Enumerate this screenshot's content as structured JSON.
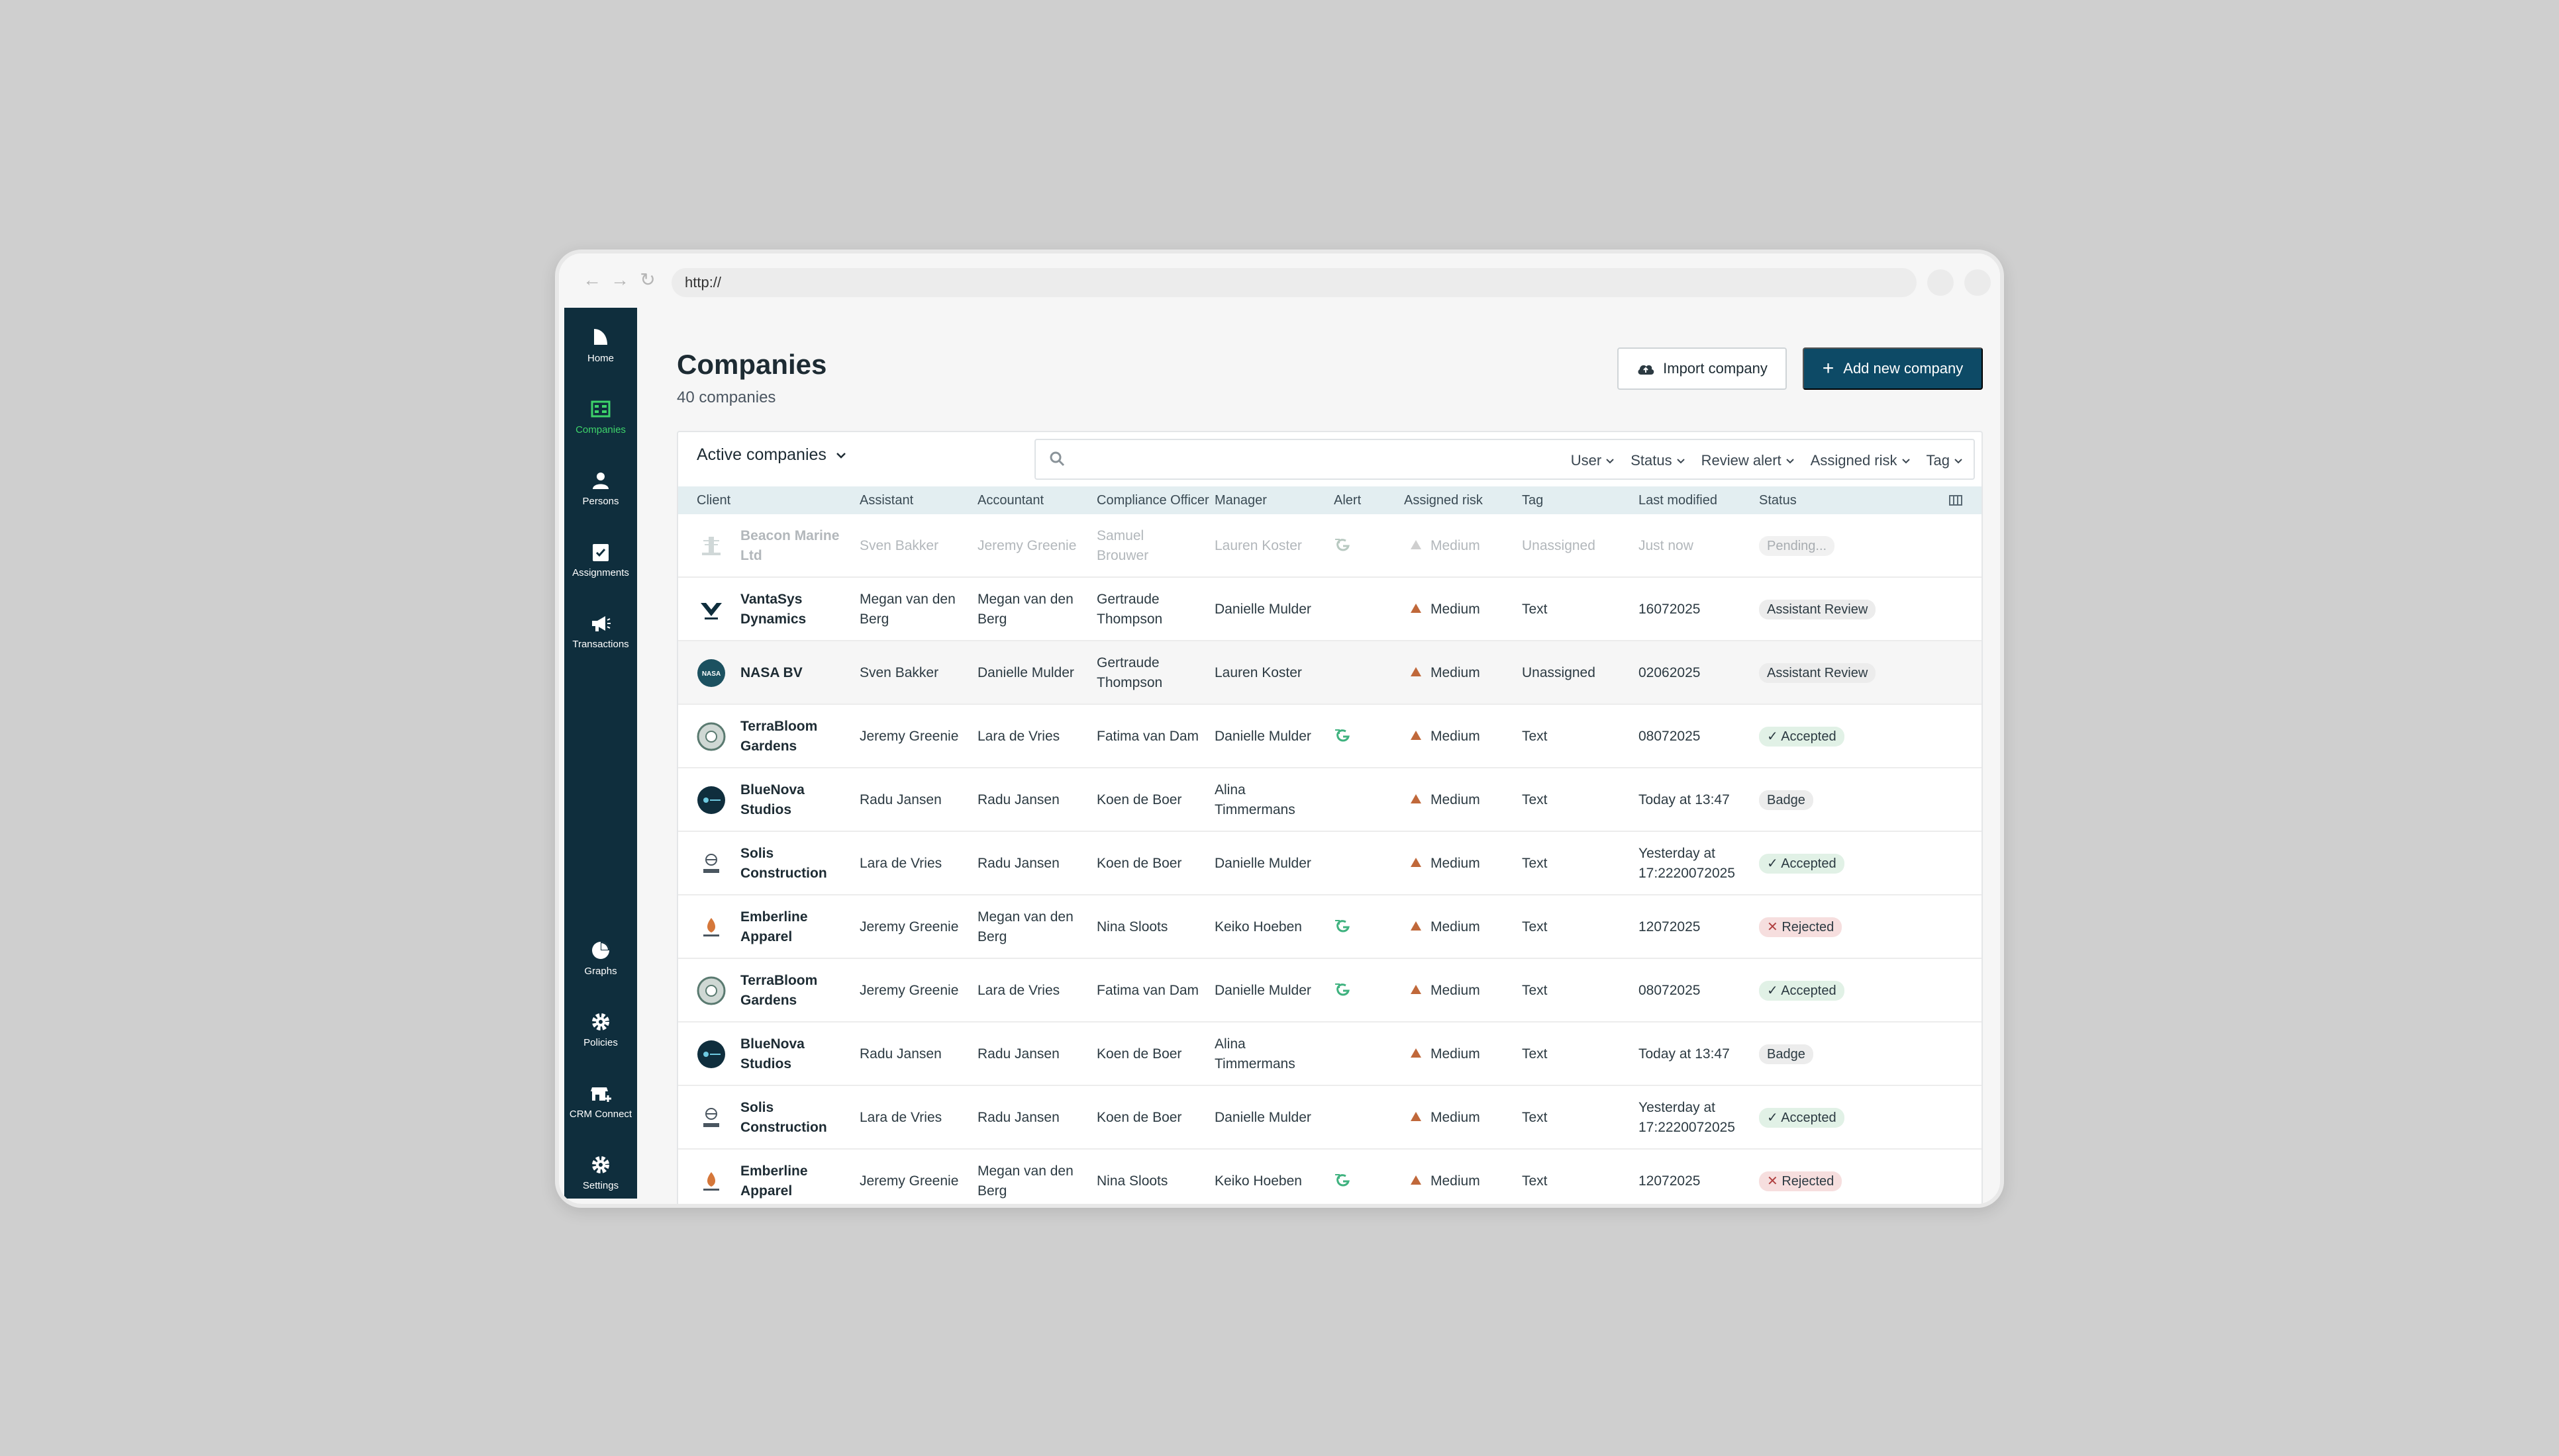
{
  "browser": {
    "url": "http://"
  },
  "sidebar": {
    "items": [
      {
        "label": "Home",
        "icon": "home-icon"
      },
      {
        "label": "Companies",
        "icon": "companies-icon",
        "active": true
      },
      {
        "label": "Persons",
        "icon": "person-icon"
      },
      {
        "label": "Assignments",
        "icon": "assignments-icon"
      },
      {
        "label": "Transactions",
        "icon": "megaphone-icon"
      },
      {
        "label": "Graphs",
        "icon": "pie-chart-icon"
      },
      {
        "label": "Policies",
        "icon": "gear-icon"
      },
      {
        "label": "CRM Connect",
        "icon": "crm-icon"
      },
      {
        "label": "Settings",
        "icon": "gear-icon"
      }
    ]
  },
  "header": {
    "title": "Companies",
    "subtitle": "40 companies",
    "import_label": "Import company",
    "add_label": "Add new company"
  },
  "filter_bar": {
    "active_label": "Active companies",
    "search_placeholder": "",
    "filters": [
      "User",
      "Status",
      "Review alert",
      "Assigned risk",
      "Tag"
    ]
  },
  "table": {
    "columns": [
      "Client",
      "Assistant",
      "Accountant",
      "Compliance Officer",
      "Manager",
      "Alert",
      "Assigned risk",
      "Tag",
      "Last modified",
      "Status"
    ],
    "rows": [
      {
        "client": [
          "Beacon Marine",
          "Ltd"
        ],
        "assistant": [
          "Sven Bakker"
        ],
        "accountant": [
          "Jeremy Greenie"
        ],
        "compliance": [
          "Samuel",
          "Brouwer"
        ],
        "manager": [
          "Lauren Koster"
        ],
        "alert": true,
        "risk": "Medium",
        "tag": "Unassigned",
        "modified": [
          "Just now"
        ],
        "status": "Pending...",
        "status_kind": "pending",
        "faded": true,
        "logo": "beacon"
      },
      {
        "client": [
          "VantaSys",
          "Dynamics"
        ],
        "assistant": [
          "Megan van den",
          "Berg"
        ],
        "accountant": [
          "Megan van den",
          "Berg"
        ],
        "compliance": [
          "Gertraude",
          "Thompson"
        ],
        "manager": [
          "Danielle Mulder"
        ],
        "alert": false,
        "risk": "Medium",
        "tag": "Text",
        "modified": [
          "16072025"
        ],
        "status": "Assistant Review",
        "status_kind": "grey",
        "logo": "vanta"
      },
      {
        "client": [
          "NASA BV"
        ],
        "assistant": [
          "Sven Bakker"
        ],
        "accountant": [
          "Danielle Mulder"
        ],
        "compliance": [
          "Gertraude",
          "Thompson"
        ],
        "manager": [
          "Lauren Koster"
        ],
        "alert": false,
        "risk": "Medium",
        "tag": "Unassigned",
        "modified": [
          "02062025"
        ],
        "status": "Assistant Review",
        "status_kind": "grey",
        "hover": true,
        "logo": "nasa"
      },
      {
        "client": [
          "TerraBloom",
          "Gardens"
        ],
        "assistant": [
          "Jeremy Greenie"
        ],
        "accountant": [
          "Lara de Vries"
        ],
        "compliance": [
          "Fatima van Dam"
        ],
        "manager": [
          "Danielle Mulder"
        ],
        "alert": true,
        "risk": "Medium",
        "tag": "Text",
        "modified": [
          "08072025"
        ],
        "status": "Accepted",
        "status_kind": "green",
        "logo": "terra"
      },
      {
        "client": [
          "BlueNova",
          "Studios"
        ],
        "assistant": [
          "Radu Jansen"
        ],
        "accountant": [
          "Radu Jansen"
        ],
        "compliance": [
          "Koen de Boer"
        ],
        "manager": [
          "Alina",
          "Timmermans"
        ],
        "alert": false,
        "risk": "Medium",
        "tag": "Text",
        "modified": [
          "Today at 13:47"
        ],
        "status": "Badge",
        "status_kind": "grey",
        "logo": "bluenova"
      },
      {
        "client": [
          "Solis",
          "Construction"
        ],
        "assistant": [
          "Lara de Vries"
        ],
        "accountant": [
          "Radu Jansen"
        ],
        "compliance": [
          "Koen de Boer"
        ],
        "manager": [
          "Danielle Mulder"
        ],
        "alert": false,
        "risk": "Medium",
        "tag": "Text",
        "modified": [
          "Yesterday at",
          "17:2220072025"
        ],
        "status": "Accepted",
        "status_kind": "green",
        "logo": "solis"
      },
      {
        "client": [
          "Emberline",
          "Apparel"
        ],
        "assistant": [
          "Jeremy Greenie"
        ],
        "accountant": [
          "Megan van den",
          "Berg"
        ],
        "compliance": [
          "Nina Sloots"
        ],
        "manager": [
          "Keiko Hoeben"
        ],
        "alert": true,
        "risk": "Medium",
        "tag": "Text",
        "modified": [
          "12072025"
        ],
        "status": "Rejected",
        "status_kind": "red",
        "logo": "ember"
      },
      {
        "client": [
          "TerraBloom",
          "Gardens"
        ],
        "assistant": [
          "Jeremy Greenie"
        ],
        "accountant": [
          "Lara de Vries"
        ],
        "compliance": [
          "Fatima van Dam"
        ],
        "manager": [
          "Danielle Mulder"
        ],
        "alert": true,
        "risk": "Medium",
        "tag": "Text",
        "modified": [
          "08072025"
        ],
        "status": "Accepted",
        "status_kind": "green",
        "logo": "terra"
      },
      {
        "client": [
          "BlueNova",
          "Studios"
        ],
        "assistant": [
          "Radu Jansen"
        ],
        "accountant": [
          "Radu Jansen"
        ],
        "compliance": [
          "Koen de Boer"
        ],
        "manager": [
          "Alina",
          "Timmermans"
        ],
        "alert": false,
        "risk": "Medium",
        "tag": "Text",
        "modified": [
          "Today at 13:47"
        ],
        "status": "Badge",
        "status_kind": "grey",
        "logo": "bluenova"
      },
      {
        "client": [
          "Solis",
          "Construction"
        ],
        "assistant": [
          "Lara de Vries"
        ],
        "accountant": [
          "Radu Jansen"
        ],
        "compliance": [
          "Koen de Boer"
        ],
        "manager": [
          "Danielle Mulder"
        ],
        "alert": false,
        "risk": "Medium",
        "tag": "Text",
        "modified": [
          "Yesterday at",
          "17:2220072025"
        ],
        "status": "Accepted",
        "status_kind": "green",
        "logo": "solis"
      },
      {
        "client": [
          "Emberline",
          "Apparel"
        ],
        "assistant": [
          "Jeremy Greenie"
        ],
        "accountant": [
          "Megan van den",
          "Berg"
        ],
        "compliance": [
          "Nina Sloots"
        ],
        "manager": [
          "Keiko Hoeben"
        ],
        "alert": true,
        "risk": "Medium",
        "tag": "Text",
        "modified": [
          "12072025"
        ],
        "status": "Rejected",
        "status_kind": "red",
        "logo": "ember"
      }
    ]
  },
  "colors": {
    "sidebar": "#0f2e3d",
    "primary": "#0d4a66",
    "active_nav": "#3ed36a",
    "risk": "#c0683a",
    "alert": "#3fb27f"
  }
}
